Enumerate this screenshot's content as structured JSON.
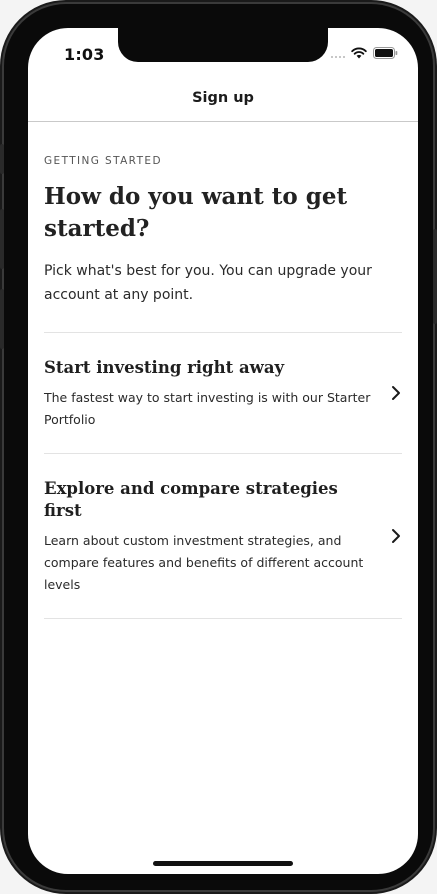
{
  "status_bar": {
    "time": "1:03",
    "icons": [
      "signal-dots-icon",
      "wifi-icon",
      "battery-icon"
    ]
  },
  "nav": {
    "title": "Sign up"
  },
  "main": {
    "eyebrow": "GETTING STARTED",
    "headline": "How do you want to get started?",
    "intro": "Pick what's best for you. You can upgrade your account at any point.",
    "options": [
      {
        "title": "Start investing right away",
        "description": "The fastest way to start investing is with our Starter Portfolio",
        "icon": "chevron-right-icon"
      },
      {
        "title": "Explore and compare strategies first",
        "description": "Learn about custom investment strategies, and compare features and benefits of different account levels",
        "icon": "chevron-right-icon"
      }
    ]
  },
  "colors": {
    "text_primary": "#1f1f1f",
    "divider": "#e3e3e3",
    "device_frame": "#0a0a0a"
  }
}
